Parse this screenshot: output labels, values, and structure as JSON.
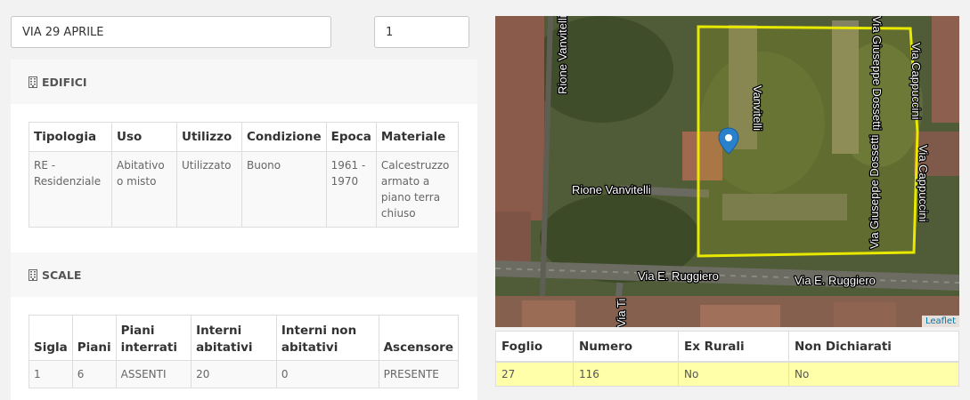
{
  "search": {
    "address_value": "VIA 29 APRILE",
    "civic_value": "1"
  },
  "edifici": {
    "title": "EDIFICI",
    "icon": "building-icon",
    "columns": [
      "Tipologia",
      "Uso",
      "Utilizzo",
      "Condizione",
      "Epoca",
      "Materiale"
    ],
    "rows": [
      [
        "RE - Residenziale",
        "Abitativo o misto",
        "Utilizzato",
        "Buono",
        "1961 - 1970",
        "Calcestruzzo armato a piano terra chiuso"
      ]
    ]
  },
  "scale": {
    "title": "SCALE",
    "icon": "building-icon",
    "columns": [
      "Sigla",
      "Piani",
      "Piani interrati",
      "Interni abitativi",
      "Interni non abitativi",
      "Ascensore"
    ],
    "rows": [
      [
        "1",
        "6",
        "ASSENTI",
        "20",
        "0",
        "PRESENTE"
      ]
    ]
  },
  "map": {
    "attribution": "Leaflet",
    "marker_icon": "map-pin-icon",
    "parcel_color": "#e8e800",
    "labels": {
      "rione_vanvitelli_v": "Rione Vanvitelli",
      "vanvitelli_v": "Vanvitelli",
      "rione_vanvitelli_h": "Rione Vanvitelli",
      "via_ruggiero_left": "Via E. Ruggiero",
      "via_ruggiero_right": "Via E. Ruggiero",
      "via_dossetti_top": "Via Giuseppe Dossetti",
      "via_dossetti_mid": "Via Giuseppe Dossetti",
      "via_cappuccini_top": "Via Cappuccini",
      "via_cappuccini_mid": "Via Cappuccini",
      "via_ti": "Via Ti"
    }
  },
  "particelle": {
    "columns": [
      "Foglio",
      "Numero",
      "Ex Rurali",
      "Non Dichiarati"
    ],
    "rows": [
      [
        "27",
        "116",
        "No",
        "No"
      ]
    ],
    "highlight_color": "#ffffaa"
  }
}
